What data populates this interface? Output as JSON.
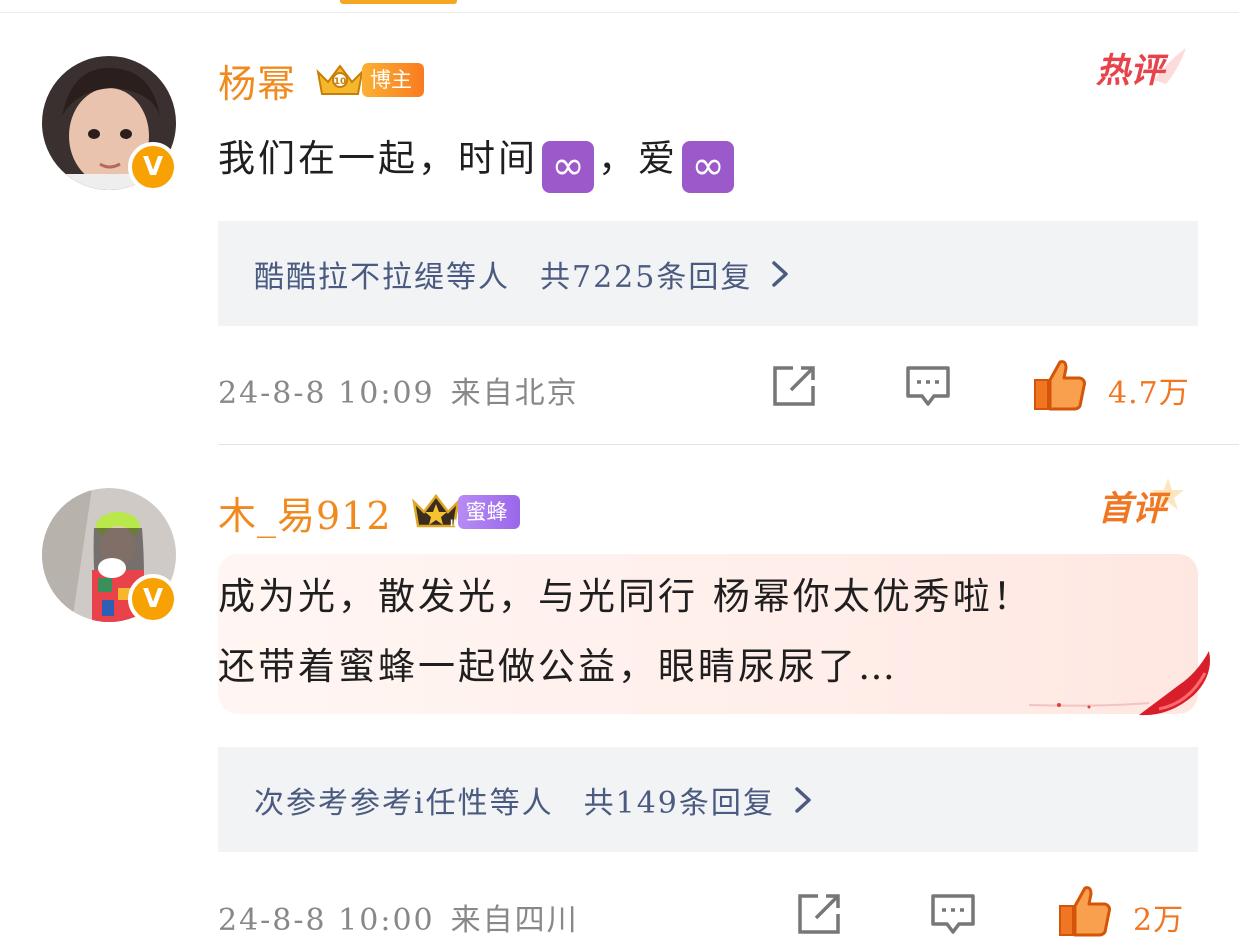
{
  "comments": [
    {
      "username": "杨幂",
      "badge": "博主",
      "tag": "热评",
      "text": "我们在一起，时间♾️，爱♾️",
      "text_parts": [
        "我们在一起，时间",
        "∞",
        "，爱",
        "∞"
      ],
      "replies_users": "酷酷拉不拉缇等人",
      "replies_count": "共7225条回复",
      "time": "24-8-8 10:09",
      "location": "来自北京",
      "likes": "4.7万"
    },
    {
      "username": "木_易912",
      "badge": "蜜蜂",
      "tag": "首评",
      "text_lines": [
        "成为光，散发光，与光同行 杨幂你太优秀啦！",
        "还带着蜜蜂一起做公益，眼睛尿尿了…"
      ],
      "replies_users": "次参考参考i任性等人",
      "replies_count": "共149条回复",
      "time": "24-8-8 10:00",
      "location": "来自四川",
      "likes": "2万"
    }
  ],
  "icons": [
    "crown-icon",
    "verified-v-icon",
    "share-icon",
    "comment-icon",
    "like-thumb-icon",
    "chevron-right-icon"
  ],
  "colors": {
    "username": "#f08a1f",
    "like": "#f07622",
    "reply_link": "#4a5a80",
    "badge_blogger": "#f97b20",
    "badge_bee": "#9a66ea",
    "verified": "#f7a102"
  }
}
